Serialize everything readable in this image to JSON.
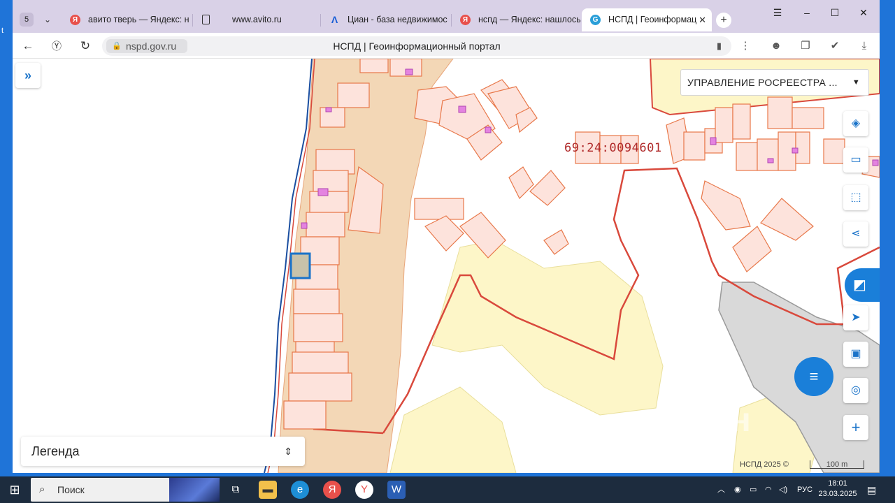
{
  "browser": {
    "tab_count": "5",
    "tabs": [
      {
        "label": "авито тверь — Яндекс: на",
        "icon": "yandex-icon",
        "color": "#e8504b"
      },
      {
        "label": "www.avito.ru",
        "icon": "document-icon",
        "color": "#333333"
      },
      {
        "label": "Циан - база недвижимос",
        "icon": "cian-icon",
        "color": "#1a5fd6"
      },
      {
        "label": "нспд — Яндекс: нашлось",
        "icon": "yandex-icon",
        "color": "#e8504b"
      },
      {
        "label": "НСПД | Геоинформац",
        "icon": "nspd-icon",
        "color": "#2a9fd8"
      }
    ],
    "url": "nspd.gov.ru",
    "page_title": "НСПД | Геоинформационный портал"
  },
  "map": {
    "layer_dropdown": "УПРАВЛЕНИЕ РОСРЕЕСТРА ...",
    "cadastral_number": "69:24:0094601",
    "legend_label": "Легенда",
    "copyright": "НСПД 2025 ©",
    "scale_label": "100 m",
    "watermark": "циан",
    "colors": {
      "parcel_stroke": "#e8784a",
      "parcel_fill": "#fde3dc",
      "zone_fill": "#f3d7b6",
      "yellow_zone": "#fdf6c8",
      "boundary": "#d9493c",
      "selected": "#1a73c9",
      "accent": "#1a7fd9"
    }
  },
  "taskbar": {
    "search_placeholder": "Поиск",
    "lang": "РУС",
    "time": "18:01",
    "date": "23.03.2025"
  }
}
